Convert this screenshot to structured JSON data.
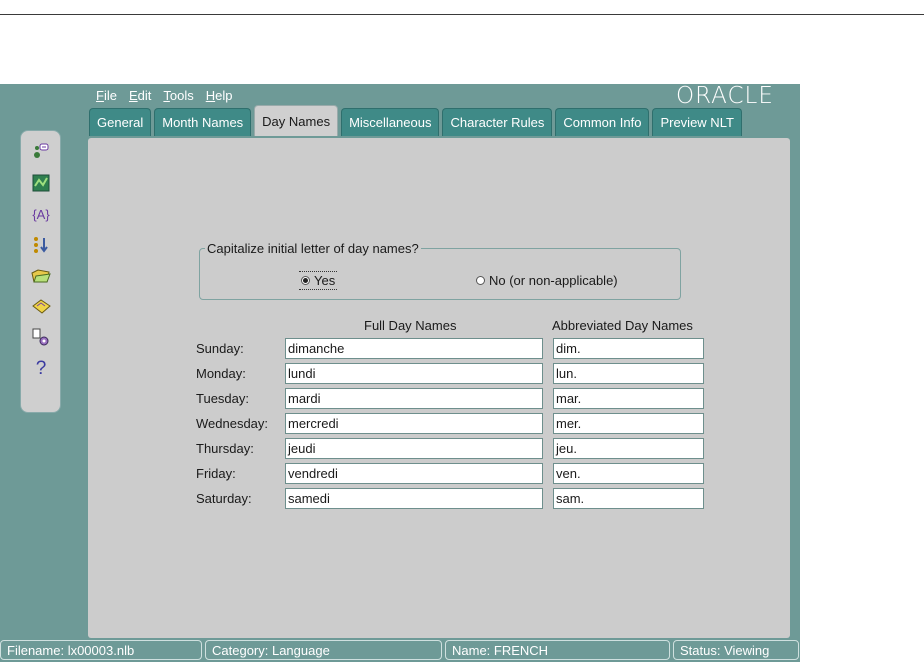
{
  "menu": [
    {
      "key": "F",
      "rest": "ile"
    },
    {
      "key": "E",
      "rest": "dit"
    },
    {
      "key": "T",
      "rest": "ools"
    },
    {
      "key": "H",
      "rest": "elp"
    }
  ],
  "brand": "ORACLE",
  "tabs": [
    "General",
    "Month Names",
    "Day Names",
    "Miscellaneous",
    "Character Rules",
    "Common Info",
    "Preview NLT"
  ],
  "active_tab": "Day Names",
  "capitalize": {
    "legend": "Capitalize initial letter of day names?",
    "yes_label": "Yes",
    "no_label": "No (or non-applicable)",
    "selected": "Yes"
  },
  "columns": {
    "full": "Full Day Names",
    "abbr": "Abbreviated Day Names"
  },
  "days": [
    {
      "label": "Sunday:",
      "full": "dimanche",
      "abbr": "dim."
    },
    {
      "label": "Monday:",
      "full": "lundi",
      "abbr": "lun."
    },
    {
      "label": "Tuesday:",
      "full": "mardi",
      "abbr": "mar."
    },
    {
      "label": "Wednesday:",
      "full": "mercredi",
      "abbr": "mer."
    },
    {
      "label": "Thursday:",
      "full": "jeudi",
      "abbr": "jeu."
    },
    {
      "label": "Friday:",
      "full": "vendredi",
      "abbr": "ven."
    },
    {
      "label": "Saturday:",
      "full": "samedi",
      "abbr": "sam."
    }
  ],
  "toolbar_icons": [
    "connect-icon",
    "map-icon",
    "variable-braces-icon",
    "sort-icon",
    "open-folder-icon",
    "save-disk-icon",
    "settings-gears-icon",
    "help-question-icon"
  ],
  "status": {
    "filename": "Filename: lx00003.nlb",
    "category": "Category: Language",
    "name": "Name: FRENCH",
    "state": "Status: Viewing"
  },
  "colors": {
    "frame": "#6e9a97",
    "tab": "#3f8a87",
    "panel": "#cccccc"
  }
}
